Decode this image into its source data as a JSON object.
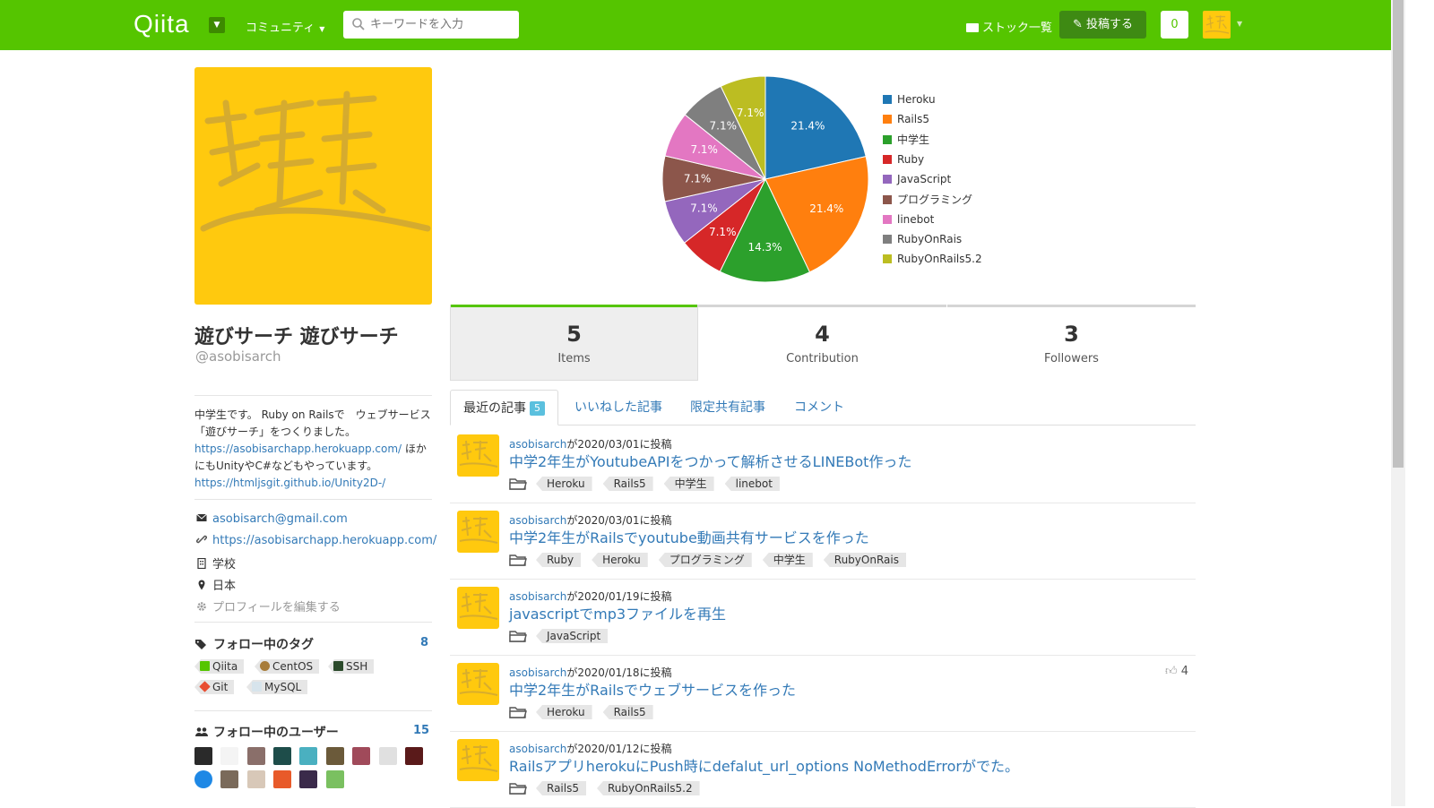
{
  "header": {
    "logo": "Qiita",
    "community_label": "コミュニティ",
    "search_placeholder": "キーワードを入力",
    "stock_label": "ストック一覧",
    "post_label": "投稿する",
    "notification_count": "0",
    "brand_color": "#55c500"
  },
  "profile": {
    "display_name": "遊びサーチ 遊びサーチ",
    "handle": "@asobisarch",
    "bio_text_1": "中学生です。 Ruby on Railsで　ウェブサービス　「遊びサーチ」をつくりました。",
    "bio_link_1": "https://asobisarchapp.herokuapp.com/",
    "bio_text_2": " ほかにもUnityやC#などもやっています。",
    "bio_link_2": "https://htmljsgit.github.io/Unity2D-/",
    "email": "asobisarch@gmail.com",
    "website": "https://asobisarchapp.herokuapp.com/",
    "organization": "学校",
    "location": "日本",
    "edit_profile": "プロフィールを編集する"
  },
  "following_tags": {
    "title": "フォロー中のタグ",
    "count": "8",
    "tags": [
      "Qiita",
      "CentOS",
      "SSH",
      "Git",
      "MySQL"
    ]
  },
  "following_users": {
    "title": "フォロー中のユーザー",
    "count": "15"
  },
  "chart_data": {
    "type": "pie",
    "labels": [
      "Heroku",
      "Rails5",
      "中学生",
      "Ruby",
      "JavaScript",
      "プログラミング",
      "linebot",
      "RubyOnRais",
      "RubyOnRails5.2"
    ],
    "values": [
      21.4,
      21.4,
      14.3,
      7.1,
      7.1,
      7.1,
      7.1,
      7.1,
      7.1
    ],
    "value_labels": [
      "21.4%",
      "21.4%",
      "14.3%",
      "7.1%",
      "7.1%",
      "7.1%",
      "7.1%",
      "7.1%",
      "7.1%"
    ],
    "colors": [
      "#1f77b4",
      "#ff7f0e",
      "#2ca02c",
      "#d62728",
      "#9467bd",
      "#8c564b",
      "#e377c2",
      "#7f7f7f",
      "#bcbd22"
    ],
    "legend_position": "right"
  },
  "stats": [
    {
      "value": "5",
      "label": "Items"
    },
    {
      "value": "4",
      "label": "Contribution"
    },
    {
      "value": "3",
      "label": "Followers"
    }
  ],
  "tabs": {
    "recent": "最近の記事",
    "recent_count": "5",
    "liked": "いいねした記事",
    "limited": "限定共有記事",
    "comments": "コメント"
  },
  "items": [
    {
      "author": "asobisarch",
      "posted": "が2020/03/01に投稿",
      "title": "中学2年生がYoutubeAPIをつかって解析させるLINEBot作った",
      "tags": [
        "Heroku",
        "Rails5",
        "中学生",
        "linebot"
      ],
      "likes": ""
    },
    {
      "author": "asobisarch",
      "posted": "が2020/03/01に投稿",
      "title": "中学2年生がRailsでyoutube動画共有サービスを作った",
      "tags": [
        "Ruby",
        "Heroku",
        "プログラミング",
        "中学生",
        "RubyOnRais"
      ],
      "likes": ""
    },
    {
      "author": "asobisarch",
      "posted": "が2020/01/19に投稿",
      "title": "javascriptでmp3ファイルを再生",
      "tags": [
        "JavaScript"
      ],
      "likes": ""
    },
    {
      "author": "asobisarch",
      "posted": "が2020/01/18に投稿",
      "title": "中学2年生がRailsでウェブサービスを作った",
      "tags": [
        "Heroku",
        "Rails5"
      ],
      "likes": "4"
    },
    {
      "author": "asobisarch",
      "posted": "が2020/01/12に投稿",
      "title": "RailsアプリherokuにPush時にdefalut_url_options NoMethodErrorがでた。",
      "tags": [
        "Rails5",
        "RubyOnRails5.2"
      ],
      "likes": ""
    }
  ]
}
